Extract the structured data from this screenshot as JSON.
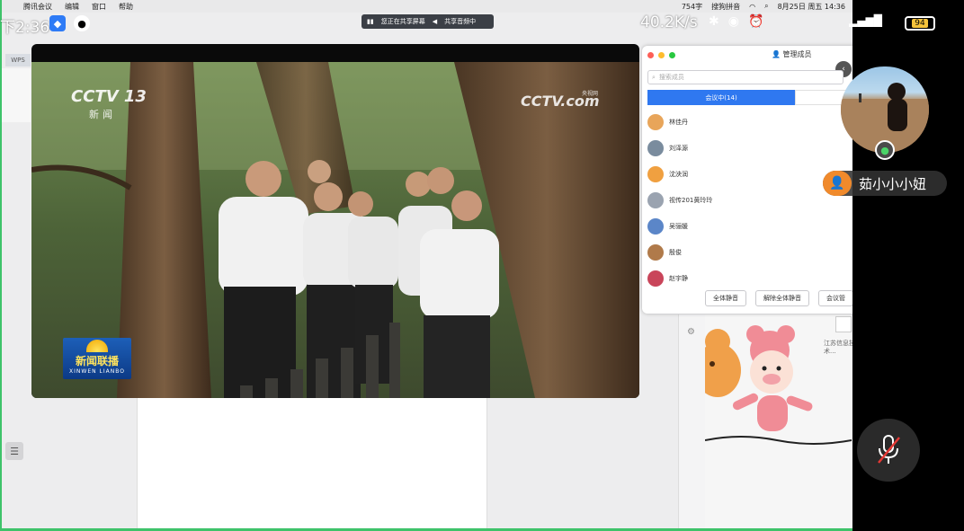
{
  "mac_menubar": {
    "apple": "",
    "items": [
      "腾讯会议",
      "编辑",
      "窗口",
      "帮助"
    ],
    "right": {
      "word_count": "754字",
      "input_method": "搜狗拼音",
      "date_time": "8月25日 周五 14:36"
    }
  },
  "phone_status": {
    "time": "下2:36",
    "net_speed": "40.2K/s",
    "battery": "94"
  },
  "share_bar": {
    "sharing": "您正在共享屏幕",
    "audio": "共享音频中"
  },
  "wps": {
    "tab": "WPS"
  },
  "video": {
    "logo_left": "CCTV 13",
    "logo_left_sub": "新闻",
    "logo_right": "CCTV.com",
    "logo_right_sub": "央视网",
    "news_title": "新闻联播",
    "news_sub": "XINWEN LIANBO"
  },
  "member_panel": {
    "title": "管理成员",
    "search_placeholder": "搜索成员",
    "tab_active": "会议中(14)",
    "members": [
      {
        "name": "林佳丹",
        "color": "#e8a55a"
      },
      {
        "name": "刘泽源",
        "color": "#7a8c9e"
      },
      {
        "name": "沈泱润",
        "color": "#f0a040"
      },
      {
        "name": "视传201黄玲玲",
        "color": "#9aa3b0"
      },
      {
        "name": "吴骊媛",
        "color": "#5b86c8"
      },
      {
        "name": "殷俊",
        "color": "#b07a4a"
      },
      {
        "name": "赵宇静",
        "color": "#c9455a"
      }
    ],
    "buttons": {
      "mute_all": "全体静音",
      "unmute_all": "解除全体静音",
      "settings": "会议管"
    }
  },
  "sticker_text": "江苏信息技术...",
  "overlay": {
    "username": "茹小小小妞"
  }
}
